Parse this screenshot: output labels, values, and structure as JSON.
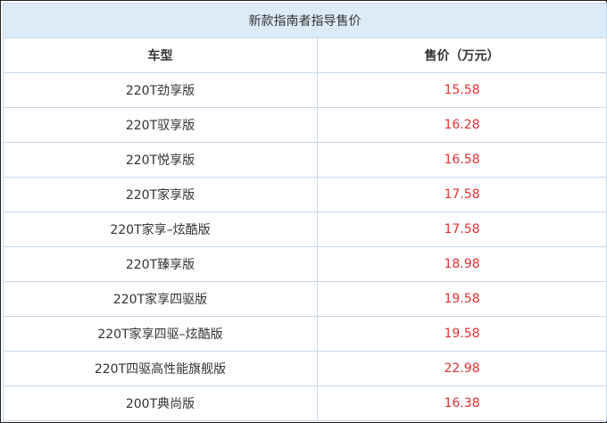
{
  "table": {
    "caption": "新款指南者指导售价",
    "headers": [
      "车型",
      "售价（万元）"
    ],
    "rows": [
      {
        "model": "220T劲享版",
        "price": "15.58"
      },
      {
        "model": "220T驭享版",
        "price": "16.28"
      },
      {
        "model": "220T悦享版",
        "price": "16.58"
      },
      {
        "model": "220T家享版",
        "price": "17.58"
      },
      {
        "model": "220T家享–炫酷版",
        "price": "17.58"
      },
      {
        "model": "220T臻享版",
        "price": "18.98"
      },
      {
        "model": "220T家享四驱版",
        "price": "19.58"
      },
      {
        "model": "220T家享四驱–炫酷版",
        "price": "19.58"
      },
      {
        "model": "220T四驱高性能旗舰版",
        "price": "22.98"
      },
      {
        "model": "200T典尚版",
        "price": "16.38"
      }
    ]
  },
  "colors": {
    "caption_bg": "#dcebf8",
    "grid_line": "#c6d8ea",
    "price_text": "#e03131",
    "text": "#333333"
  }
}
